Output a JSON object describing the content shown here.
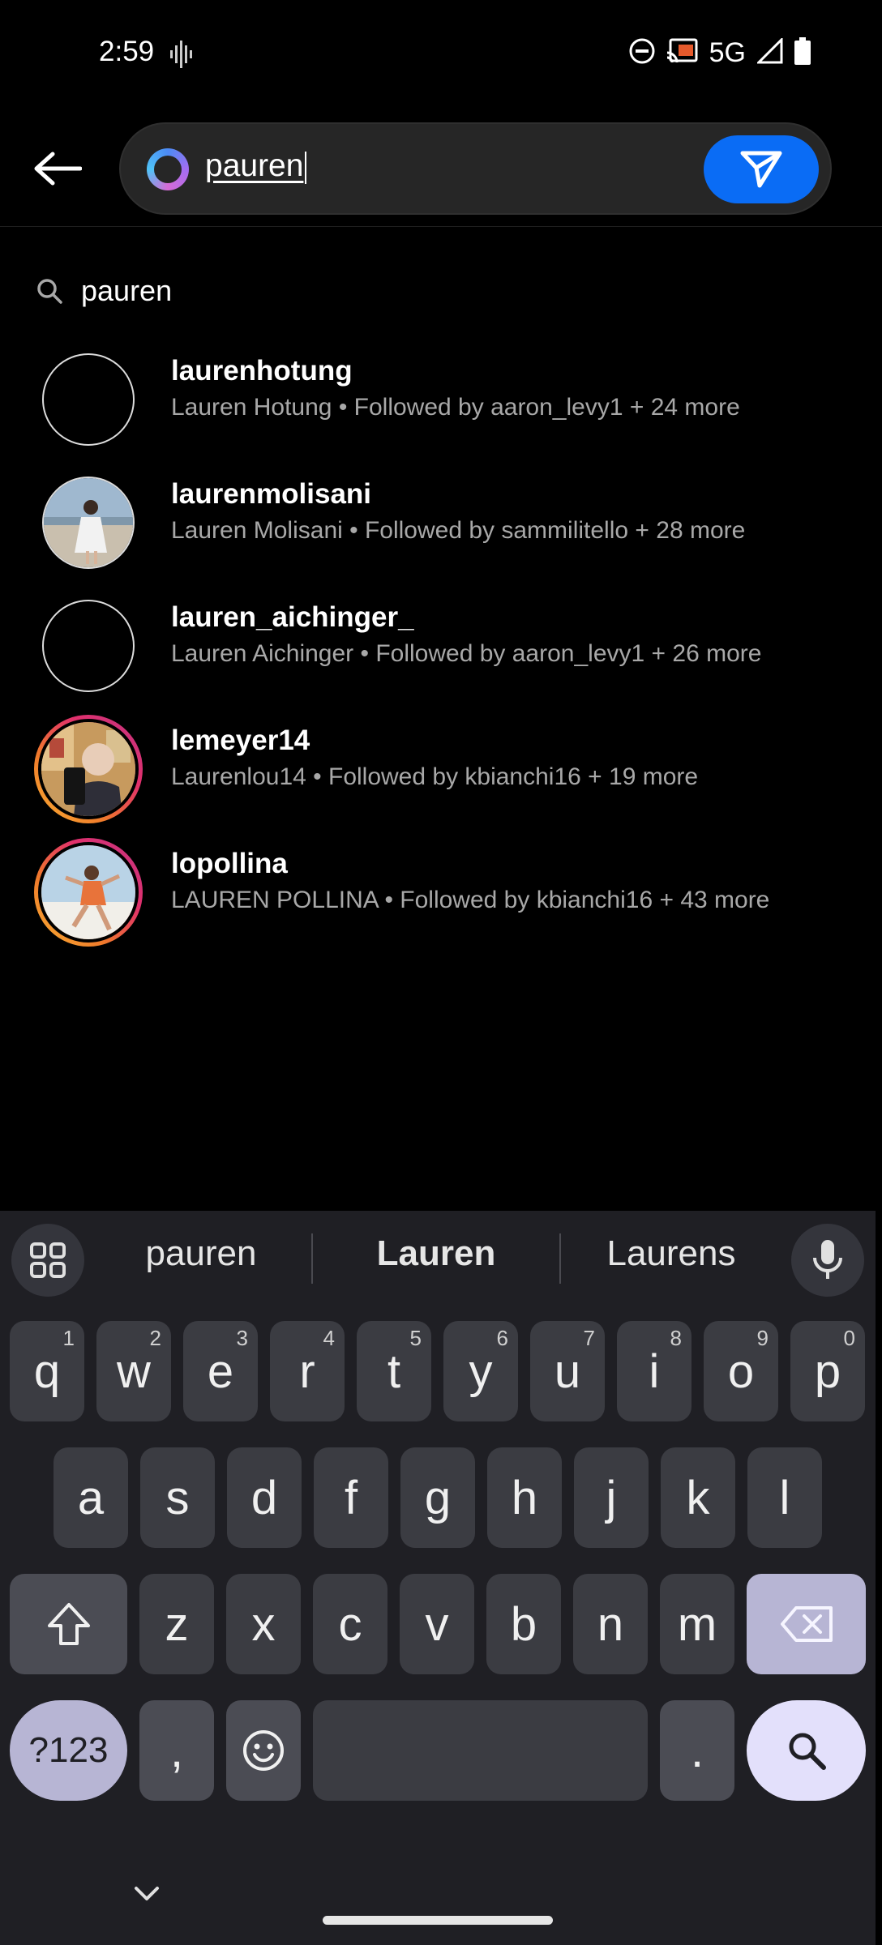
{
  "status": {
    "time": "2:59",
    "network": "5G"
  },
  "search": {
    "query": "pauren",
    "suggestion": "pauren"
  },
  "results": [
    {
      "username": "laurenhotung",
      "subtitle": "Lauren Hotung • Followed by aaron_levy1 + 24 more"
    },
    {
      "username": "laurenmolisani",
      "subtitle": "Lauren Molisani • Followed by sammilitello + 28 more"
    },
    {
      "username": "lauren_aichinger_",
      "subtitle": "Lauren Aichinger • Followed by aaron_levy1 + 26 more"
    },
    {
      "username": "lemeyer14",
      "subtitle": "Laurenlou14 • Followed by kbianchi16 + 19 more"
    },
    {
      "username": "lopollina",
      "subtitle": "LAUREN POLLINA • Followed by kbianchi16 + 43 more"
    }
  ],
  "keyboard": {
    "suggestions": [
      "pauren",
      "Lauren",
      "Laurens"
    ],
    "row1": [
      {
        "k": "q",
        "n": "1"
      },
      {
        "k": "w",
        "n": "2"
      },
      {
        "k": "e",
        "n": "3"
      },
      {
        "k": "r",
        "n": "4"
      },
      {
        "k": "t",
        "n": "5"
      },
      {
        "k": "y",
        "n": "6"
      },
      {
        "k": "u",
        "n": "7"
      },
      {
        "k": "i",
        "n": "8"
      },
      {
        "k": "o",
        "n": "9"
      },
      {
        "k": "p",
        "n": "0"
      }
    ],
    "row2": [
      "a",
      "s",
      "d",
      "f",
      "g",
      "h",
      "j",
      "k",
      "l"
    ],
    "row3": [
      "z",
      "x",
      "c",
      "v",
      "b",
      "n",
      "m"
    ],
    "symbols_label": "?123",
    "comma": ",",
    "period": "."
  }
}
